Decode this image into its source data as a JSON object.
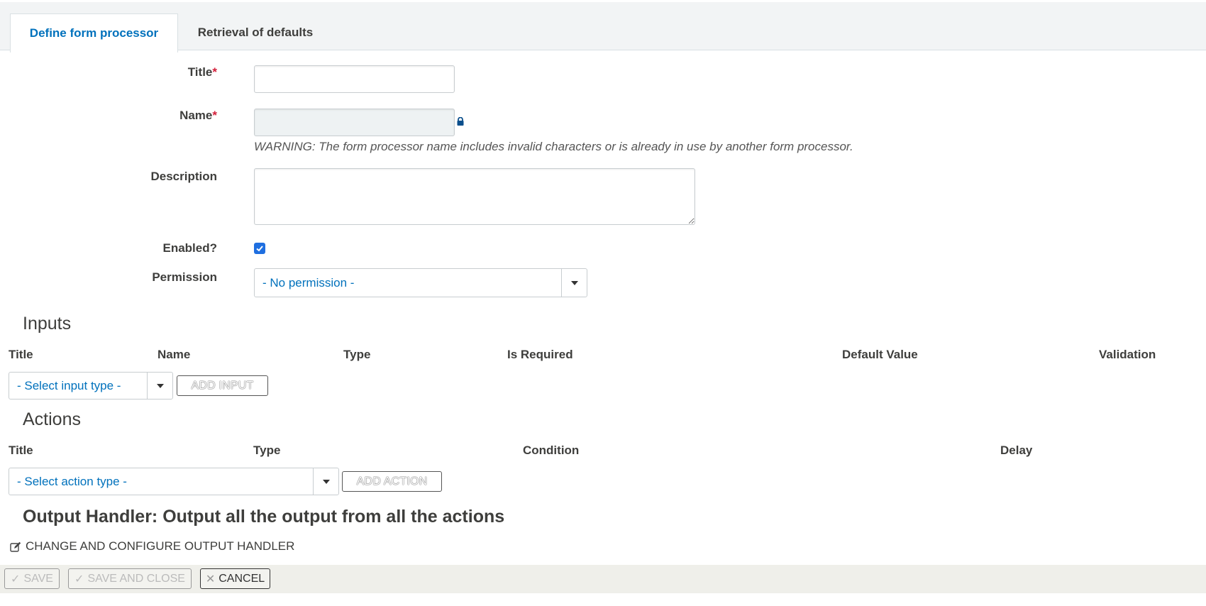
{
  "tabs": [
    {
      "label": "Define form processor",
      "active": true
    },
    {
      "label": "Retrieval of defaults",
      "active": false
    }
  ],
  "form": {
    "title_label": "Title",
    "name_label": "Name",
    "required_mark": "*",
    "warning": "WARNING: The form processor name includes invalid characters or is already in use by another form processor.",
    "description_label": "Description",
    "enabled_label": "Enabled?",
    "enabled_checked": true,
    "permission_label": "Permission",
    "permission_value": "- No permission -"
  },
  "inputs": {
    "heading": "Inputs",
    "columns": [
      "Title",
      "Name",
      "Type",
      "Is Required",
      "Default Value",
      "Validation"
    ],
    "select_placeholder": "- Select input type -",
    "add_button": "ADD INPUT"
  },
  "actions": {
    "heading": "Actions",
    "columns": [
      "Title",
      "Type",
      "Condition",
      "Delay"
    ],
    "select_placeholder": "- Select action type -",
    "add_button": "ADD ACTION"
  },
  "output_handler": {
    "heading": "Output Handler: Output all the output from all the actions",
    "change_link": "CHANGE AND CONFIGURE OUTPUT HANDLER"
  },
  "footer": {
    "save": "SAVE",
    "save_close": "SAVE AND CLOSE",
    "cancel": "CANCEL"
  },
  "colors": {
    "accent": "#0071bc",
    "required": "#d31f3a",
    "checkbox": "#1f6fe0"
  }
}
